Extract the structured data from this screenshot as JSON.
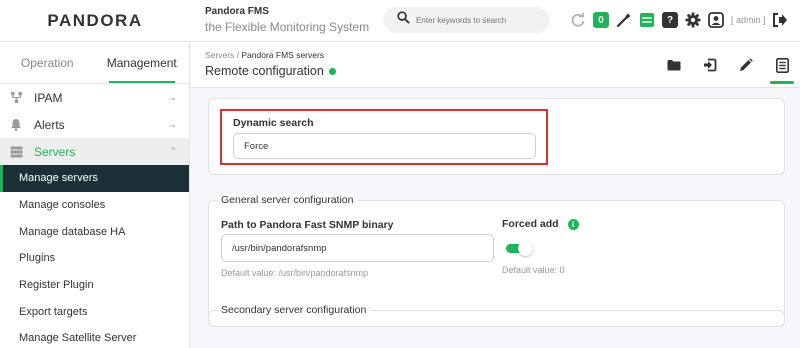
{
  "header": {
    "logo": "PANDORA",
    "brand_name": "Pandora FMS",
    "brand_tagline": "the Flexible Monitoring System",
    "search_placeholder": "Enter keywords to search",
    "notification_count": "0",
    "admin_label": "[ admin ]",
    "accent_color": "#20b35a"
  },
  "sidebar": {
    "tabs": [
      {
        "label": "Operation",
        "active": false
      },
      {
        "label": "Management",
        "active": true
      }
    ],
    "items": [
      {
        "label": "IPAM",
        "icon": "network-icon"
      },
      {
        "label": "Alerts",
        "icon": "bell-icon"
      },
      {
        "label": "Servers",
        "icon": "server-icon",
        "expanded": true
      }
    ],
    "sub_items": [
      {
        "label": "Manage servers",
        "active": true
      },
      {
        "label": "Manage consoles"
      },
      {
        "label": "Manage database HA"
      },
      {
        "label": "Plugins"
      },
      {
        "label": "Register Plugin"
      },
      {
        "label": "Export targets"
      },
      {
        "label": "Manage Satellite Server"
      }
    ]
  },
  "content": {
    "breadcrumb": {
      "parent": "Servers",
      "separator": " / ",
      "current": "Pandora FMS servers"
    },
    "title": "Remote configuration",
    "dynamic_search": {
      "label": "Dynamic search",
      "value": "Force"
    },
    "general": {
      "legend": "General server configuration",
      "snmp_label": "Path to Pandora Fast SNMP binary",
      "snmp_value": "/usr/bin/pandorafsnmp",
      "snmp_default": "Default value: /usr/bin/pandorafsnmp",
      "forced_add_label": "Forced add",
      "forced_add_on": true,
      "forced_add_default": "Default value: 0"
    },
    "secondary": {
      "legend": "Secondary server configuration"
    }
  }
}
